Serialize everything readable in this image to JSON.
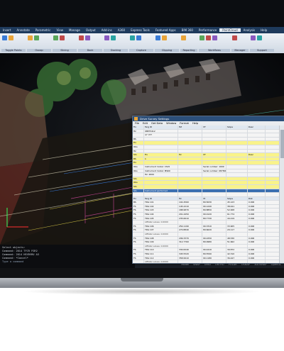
{
  "app": {
    "ribbon_tabs": [
      "Insert",
      "Annotate",
      "Parametric",
      "View",
      "Manage",
      "Output",
      "Add-ins",
      "A360",
      "Express Tools",
      "Featured Apps",
      "BIM 360",
      "Performance",
      "PointCloud",
      "Analysis",
      "Help"
    ],
    "active_tab": "PointCloud",
    "ribbon_groups": [
      {
        "label": "Toggle Points",
        "buttons": [
          "Refresh",
          "Auto Point"
        ]
      },
      {
        "label": "Osnap",
        "buttons": [
          "Toggle Snaps",
          "Snaps"
        ]
      },
      {
        "label": "Slicing",
        "buttons": [
          "Slice",
          "Fence"
        ]
      },
      {
        "label": "Dock",
        "buttons": [
          "Dock",
          "Align"
        ]
      },
      {
        "label": "Docking",
        "buttons": [
          "Blocks on Grid",
          "Clear Set Ex"
        ]
      },
      {
        "label": "Capture",
        "buttons": [
          "Create Dock",
          "Capture Set"
        ]
      },
      {
        "label": "Clipping",
        "buttons": [
          "Clip",
          "Lower"
        ]
      },
      {
        "label": "Reporting",
        "buttons": [
          "Report"
        ]
      },
      {
        "label": "Workflows",
        "buttons": [
          "Open Toolpack",
          "Add Toolpack",
          "Open Workflow"
        ]
      },
      {
        "label": "Manager",
        "buttons": [
          "Manager"
        ]
      },
      {
        "label": "Support",
        "buttons": [
          "Help",
          "QA"
        ]
      }
    ]
  },
  "command_line": {
    "lines": [
      "Select objects:",
      "Command: 2014 TFCR FGR2",
      "Command:  2014 HEXRVRU A3",
      "Command:  *Cancel*"
    ],
    "prompt": "Type a command"
  },
  "status": {
    "left": "Model",
    "right": [
      "SNAP",
      "GRID",
      "ORTHO",
      "POLAR",
      "OSNAP",
      "3DOSNAP",
      "OpenGL"
    ]
  },
  "editor": {
    "title": "Drive Survey Settings",
    "menu": [
      "File",
      "Edit",
      "Get Data",
      "Window",
      "Format",
      "Help"
    ],
    "rows": [
      {
        "cls": "hdr",
        "cells": [
          "Fix",
          "Targ ID",
          "HZ",
          "VT",
          "Slope",
          "Desc"
        ]
      },
      {
        "cls": "",
        "cells": [
          "Hz",
          "98875412",
          "",
          "",
          "",
          ""
        ]
      },
      {
        "cls": "note",
        "cells": [
          "",
          "GF PPT",
          "",
          "",
          "",
          ""
        ]
      },
      {
        "cls": "",
        "cells": [
          "BS",
          "",
          "",
          "",
          "",
          ""
        ]
      },
      {
        "cls": "y",
        "cells": [
          "Fix",
          "",
          "",
          "",
          "",
          ""
        ]
      },
      {
        "cls": "",
        "cells": [
          "Obs",
          "",
          "",
          "",
          "",
          ""
        ]
      },
      {
        "cls": "",
        "cells": [
          "Hz",
          "",
          "",
          "",
          "",
          ""
        ]
      },
      {
        "cls": "y",
        "cells": [
          "Stn",
          "Fix",
          "Hz",
          "VT",
          "",
          "Desc"
        ]
      },
      {
        "cls": "y",
        "cells": [
          "BS",
          "1",
          "",
          "",
          "",
          ""
        ]
      },
      {
        "cls": "y",
        "cells": [
          "Fix",
          "",
          "",
          "",
          "",
          ""
        ]
      },
      {
        "cls": "",
        "cells": [
          "Obs",
          "Instrument model: CS15",
          "",
          "Serial number: 1009",
          "",
          ""
        ]
      },
      {
        "cls": "",
        "cells": [
          "Obs",
          "Instrument model: MS60",
          "",
          "Serial number: 087800",
          "",
          ""
        ]
      },
      {
        "cls": "",
        "cells": [
          "",
          "Hz: 2000",
          "",
          "",
          "",
          ""
        ]
      },
      {
        "cls": "y",
        "cells": [
          "Stn",
          "",
          "",
          "",
          "",
          ""
        ]
      },
      {
        "cls": "y",
        "cells": [
          "Obs",
          "",
          "",
          "",
          "",
          ""
        ]
      },
      {
        "cls": "y",
        "cells": [
          "Stn",
          "",
          "",
          "",
          "",
          ""
        ]
      },
      {
        "cls": "sel",
        "cells": [
          "Stn",
          "Instrument performed",
          "",
          "",
          "",
          ""
        ]
      },
      {
        "cls": "",
        "cells": [
          "",
          "",
          "",
          "",
          "",
          ""
        ]
      },
      {
        "cls": "hdr",
        "cells": [
          "Fix",
          "Targ ID",
          "Hz",
          "Vt",
          "Slope",
          "Dist"
        ]
      },
      {
        "cls": "",
        "cells": [
          "BS",
          "TRG 101",
          "102.4560",
          "89.5630",
          "45.123",
          "0.000"
        ]
      },
      {
        "cls": "",
        "cells": [
          "FS",
          "TRG 102",
          "145.2210",
          "90.1240",
          "38.441",
          "0.000"
        ]
      },
      {
        "cls": "",
        "cells": [
          "FS",
          "TRG 103",
          "188.9870",
          "89.8850",
          "52.008",
          "0.000"
        ]
      },
      {
        "cls": "",
        "cells": [
          "FS",
          "TRG 104",
          "201.4450",
          "90.0120",
          "61.774",
          "0.000"
        ]
      },
      {
        "cls": "",
        "cells": [
          "FS",
          "TRG 105",
          "235.6610",
          "89.7730",
          "44.219",
          "0.000"
        ]
      },
      {
        "cls": "note",
        "cells": [
          "",
          "LPPatel values: 0.0000",
          "",
          "",
          "",
          ""
        ]
      },
      {
        "cls": "",
        "cells": [
          "FS",
          "TRG 106",
          "250.1190",
          "90.3310",
          "33.905",
          "0.000"
        ]
      },
      {
        "cls": "",
        "cells": [
          "FS",
          "TRG 107",
          "270.8840",
          "89.6620",
          "29.117",
          "0.000"
        ]
      },
      {
        "cls": "note",
        "cells": [
          "",
          "LPPatel values: 0.0000",
          "",
          "",
          "",
          ""
        ]
      },
      {
        "cls": "",
        "cells": [
          "FS",
          "TRG 108",
          "299.3370",
          "90.2250",
          "48.530",
          "0.000"
        ]
      },
      {
        "cls": "",
        "cells": [
          "FS",
          "TRG 109",
          "312.7760",
          "89.9980",
          "51.662",
          "0.000"
        ]
      },
      {
        "cls": "note",
        "cells": [
          "",
          "LPPatel values: 0.0000",
          "",
          "",
          "",
          ""
        ]
      },
      {
        "cls": "",
        "cells": [
          "FS",
          "TRG 110",
          "330.0040",
          "90.4410",
          "39.872",
          "0.000"
        ]
      },
      {
        "cls": "",
        "cells": [
          "FS",
          "TRG 111",
          "345.5520",
          "89.5590",
          "42.310",
          "0.000"
        ]
      },
      {
        "cls": "",
        "cells": [
          "FS",
          "TRG 112",
          "358.9910",
          "90.1180",
          "36.447",
          "0.000"
        ]
      },
      {
        "cls": "note",
        "cells": [
          "",
          "LPPatel values: 0.0000",
          "",
          "",
          "",
          ""
        ]
      },
      {
        "cls": "",
        "cells": [
          "FS",
          "TRG 113",
          "12.3360",
          "89.8870",
          "55.094",
          "0.000"
        ]
      },
      {
        "cls": "",
        "cells": [
          "FS",
          "TRG 114",
          "25.6670",
          "90.0030",
          "47.215",
          "0.000"
        ]
      },
      {
        "cls": "",
        "cells": [
          "FS",
          "TRG 115",
          "48.1190",
          "89.7720",
          "50.663",
          "0.000"
        ]
      }
    ]
  },
  "colors": {
    "ribbon": "#eef2f7",
    "accent": "#2c4f7a",
    "highlight": "#f9f38a",
    "select": "#3b6fb0"
  }
}
